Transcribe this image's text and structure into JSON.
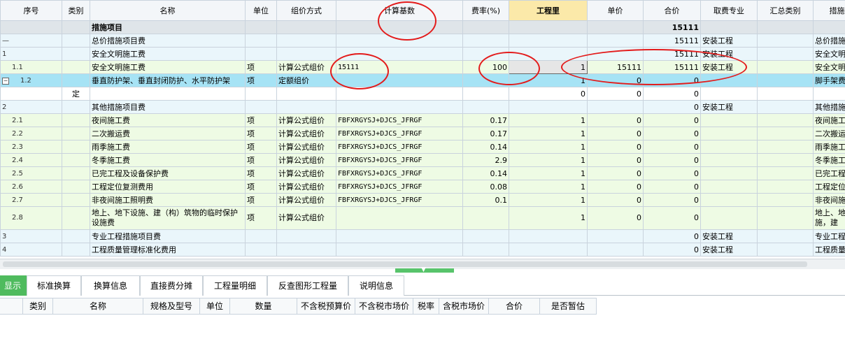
{
  "columns": [
    "序号",
    "类别",
    "名称",
    "单位",
    "组价方式",
    "计算基数",
    "费率(%)",
    "工程里",
    "单价",
    "合价",
    "取费专业",
    "汇总类别",
    "措施"
  ],
  "rows": [
    {
      "seq": "",
      "cat": "",
      "name": "措施项目",
      "unit": "",
      "method": "",
      "base": "",
      "rate": "",
      "qty": "",
      "price": "",
      "total": "15111",
      "spec": "",
      "sum": "",
      "ext": ""
    },
    {
      "seq": "—",
      "cat": "",
      "name": "总价措施项目费",
      "unit": "",
      "method": "",
      "base": "",
      "rate": "",
      "qty": "",
      "price": "",
      "total": "15111",
      "spec": "安装工程",
      "sum": "",
      "ext": "总价措施"
    },
    {
      "seq": "1",
      "cat": "",
      "name": "安全文明施工费",
      "unit": "",
      "method": "",
      "base": "",
      "rate": "",
      "qty": "",
      "price": "",
      "total": "15111",
      "spec": "安装工程",
      "sum": "",
      "ext": "安全文明"
    },
    {
      "seq": "1.1",
      "cat": "",
      "name": "安全文明施工费",
      "unit": "项",
      "method": "计算公式组价",
      "base": "15111",
      "rate": "100",
      "qty": "1",
      "price": "15111",
      "total": "15111",
      "spec": "安装工程",
      "sum": "",
      "ext": "安全文明"
    },
    {
      "seq": "1.2",
      "cat": "",
      "name": "垂直防护架、垂直封闭防护、水平防护架",
      "unit": "项",
      "method": "定额组价",
      "base": "",
      "rate": "",
      "qty": "1",
      "price": "0",
      "total": "0",
      "spec": "",
      "sum": "",
      "ext": "脚手架费"
    },
    {
      "seq": "",
      "cat": "定",
      "name": "",
      "unit": "",
      "method": "",
      "base": "",
      "rate": "",
      "qty": "0",
      "price": "0",
      "total": "0",
      "spec": "",
      "sum": "",
      "ext": ""
    },
    {
      "seq": "2",
      "cat": "",
      "name": "其他措施项目费",
      "unit": "",
      "method": "",
      "base": "",
      "rate": "",
      "qty": "",
      "price": "",
      "total": "0",
      "spec": "安装工程",
      "sum": "",
      "ext": "其他措施"
    },
    {
      "seq": "2.1",
      "cat": "",
      "name": "夜间施工费",
      "unit": "项",
      "method": "计算公式组价",
      "base": "FBFXRGYSJ+DJCS_JFRGF",
      "rate": "0.17",
      "qty": "1",
      "price": "0",
      "total": "0",
      "spec": "",
      "sum": "",
      "ext": "夜间施工"
    },
    {
      "seq": "2.2",
      "cat": "",
      "name": "二次搬运费",
      "unit": "项",
      "method": "计算公式组价",
      "base": "FBFXRGYSJ+DJCS_JFRGF",
      "rate": "0.17",
      "qty": "1",
      "price": "0",
      "total": "0",
      "spec": "",
      "sum": "",
      "ext": "二次搬运"
    },
    {
      "seq": "2.3",
      "cat": "",
      "name": "雨季施工费",
      "unit": "项",
      "method": "计算公式组价",
      "base": "FBFXRGYSJ+DJCS_JFRGF",
      "rate": "0.14",
      "qty": "1",
      "price": "0",
      "total": "0",
      "spec": "",
      "sum": "",
      "ext": "雨季施工"
    },
    {
      "seq": "2.4",
      "cat": "",
      "name": "冬季施工费",
      "unit": "项",
      "method": "计算公式组价",
      "base": "FBFXRGYSJ+DJCS_JFRGF",
      "rate": "2.9",
      "qty": "1",
      "price": "0",
      "total": "0",
      "spec": "",
      "sum": "",
      "ext": "冬季施工"
    },
    {
      "seq": "2.5",
      "cat": "",
      "name": "已完工程及设备保护费",
      "unit": "项",
      "method": "计算公式组价",
      "base": "FBFXRGYSJ+DJCS_JFRGF",
      "rate": "0.14",
      "qty": "1",
      "price": "0",
      "total": "0",
      "spec": "",
      "sum": "",
      "ext": "已完工程"
    },
    {
      "seq": "2.6",
      "cat": "",
      "name": "工程定位复测费用",
      "unit": "项",
      "method": "计算公式组价",
      "base": "FBFXRGYSJ+DJCS_JFRGF",
      "rate": "0.08",
      "qty": "1",
      "price": "0",
      "total": "0",
      "spec": "",
      "sum": "",
      "ext": "工程定位"
    },
    {
      "seq": "2.7",
      "cat": "",
      "name": "非夜间施工照明费",
      "unit": "项",
      "method": "计算公式组价",
      "base": "FBFXRGYSJ+DJCS_JFRGF",
      "rate": "0.1",
      "qty": "1",
      "price": "0",
      "total": "0",
      "spec": "",
      "sum": "",
      "ext": "非夜间施"
    },
    {
      "seq": "2.8",
      "cat": "",
      "name": "地上、地下设施、建（构）筑物的临时保护设施费",
      "unit": "项",
      "method": "计算公式组价",
      "base": "",
      "rate": "",
      "qty": "1",
      "price": "0",
      "total": "0",
      "spec": "",
      "sum": "",
      "ext": "地上、地施，建"
    },
    {
      "seq": "3",
      "cat": "",
      "name": "专业工程措施项目费",
      "unit": "",
      "method": "",
      "base": "",
      "rate": "",
      "qty": "",
      "price": "",
      "total": "0",
      "spec": "安装工程",
      "sum": "",
      "ext": "专业工程"
    },
    {
      "seq": "4",
      "cat": "",
      "name": "工程质量管理标准化费用",
      "unit": "",
      "method": "",
      "base": "",
      "rate": "",
      "qty": "",
      "price": "",
      "total": "0",
      "spec": "安装工程",
      "sum": "",
      "ext": "工程质量"
    }
  ],
  "bottom_tabs": [
    "显示",
    "标准换算",
    "换算信息",
    "直接费分摊",
    "工程量明细",
    "反查图形工程量",
    "说明信息"
  ],
  "bottom_columns": [
    "",
    "类别",
    "名称",
    "规格及型号",
    "单位",
    "数量",
    "不含税预算价",
    "不含税市场价",
    "税率",
    "含税市场价",
    "合价",
    "是否暂估"
  ],
  "accent_color": "#4fbb5e",
  "selected_row_color": "#a6e3f5"
}
